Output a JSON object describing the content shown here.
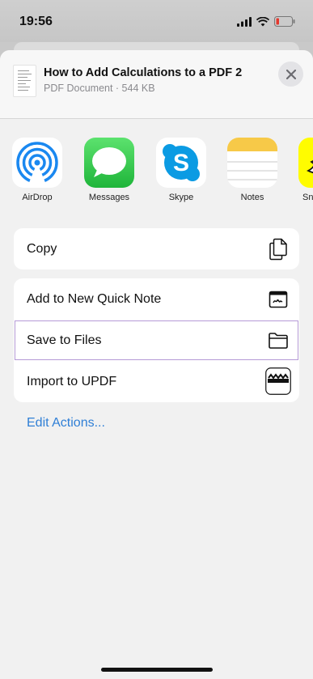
{
  "status_bar": {
    "time": "19:56"
  },
  "header": {
    "title": "How to Add Calculations to a PDF 2",
    "meta": "PDF Document · 544 KB"
  },
  "apps": [
    {
      "name": "AirDrop",
      "icon": "airdrop-icon"
    },
    {
      "name": "Messages",
      "icon": "messages-icon"
    },
    {
      "name": "Skype",
      "icon": "skype-icon"
    },
    {
      "name": "Notes",
      "icon": "notes-icon"
    },
    {
      "name": "Sn",
      "icon": "snapchat-icon"
    }
  ],
  "actions_group1": [
    {
      "label": "Copy",
      "icon": "copy-icon"
    }
  ],
  "actions_group2": [
    {
      "label": "Add to New Quick Note",
      "icon": "quick-note-icon"
    },
    {
      "label": "Save to Files",
      "icon": "folder-icon"
    },
    {
      "label": "Import to UPDF",
      "icon": "updf-icon"
    }
  ],
  "edit_actions": "Edit Actions...",
  "colors": {
    "accent": "#2f7fd6",
    "highlight": "#b59ad6",
    "messages_green": "#34c759",
    "skype_blue": "#0b9be3",
    "notes_yellow": "#f7c948",
    "snap_yellow": "#fffc00"
  }
}
